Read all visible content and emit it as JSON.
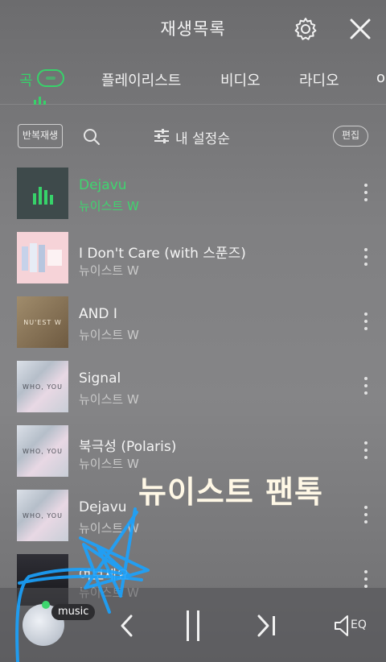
{
  "header": {
    "title": "재생목록"
  },
  "tabs": [
    {
      "label": "곡",
      "active": true
    },
    {
      "label": "플레이리스트",
      "active": false
    },
    {
      "label": "비디오",
      "active": false
    },
    {
      "label": "라디오",
      "active": false
    },
    {
      "label": "o",
      "active": false
    }
  ],
  "toolbar": {
    "repeat_label": "반복재생",
    "sort_label": "내 설정순",
    "edit_label": "편집"
  },
  "songs": [
    {
      "title": "Dejavu",
      "artist": "뉴이스트 W",
      "playing": true
    },
    {
      "title": "I Don't Care (with 스푼즈)",
      "artist": "뉴이스트 W",
      "playing": false
    },
    {
      "title": "AND I",
      "artist": "뉴이스트 W",
      "playing": false,
      "cover_text": "NU'EST W"
    },
    {
      "title": "Signal",
      "artist": "뉴이스트 W",
      "playing": false,
      "cover_text": "WHO, YOU"
    },
    {
      "title": "북극성 (Polaris)",
      "artist": "뉴이스트 W",
      "playing": false,
      "cover_text": "WHO, YOU"
    },
    {
      "title": "Dejavu",
      "artist": "뉴이스트 W",
      "playing": false,
      "cover_text": "WHO, YOU"
    },
    {
      "title": "여보세요",
      "artist": "뉴이스트 W",
      "playing": false
    }
  ],
  "overlay": {
    "caption": "뉴이스트 팬톡"
  },
  "player": {
    "badge": "music",
    "eq_label": "EQ"
  },
  "colors": {
    "accent_green": "#37d26a",
    "scribble_blue": "#1aa3ff"
  },
  "icons": [
    "gear-icon",
    "close-icon",
    "search-icon",
    "sort-icon",
    "more-vertical-icon",
    "previous-icon",
    "pause-icon",
    "next-icon",
    "speaker-eq-icon"
  ]
}
